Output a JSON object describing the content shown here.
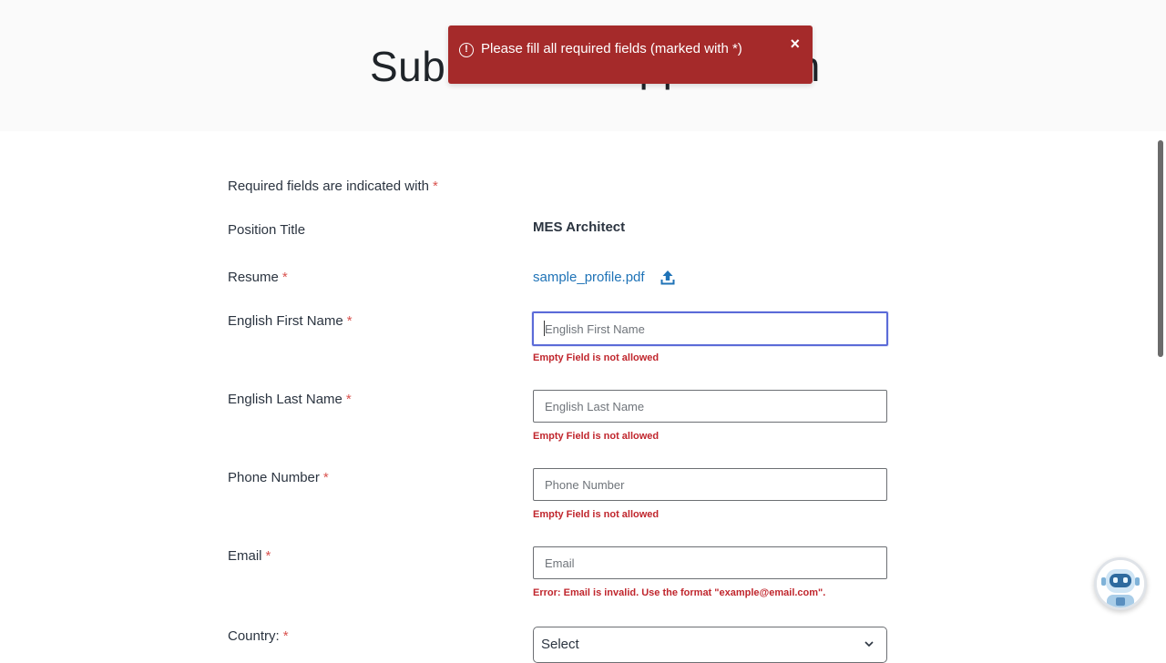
{
  "header": {
    "title": "Submit Your Application"
  },
  "toast": {
    "icon": "alert-circle-icon",
    "message": "Please fill all required fields (marked with *)",
    "close": "×"
  },
  "form": {
    "required_note": "Required fields are indicated with",
    "required_marker": "*",
    "position_title": {
      "label": "Position Title",
      "value": "MES Architect"
    },
    "resume": {
      "label": "Resume",
      "file_name": "sample_profile.pdf",
      "icon": "upload-icon"
    },
    "first_name": {
      "label": "English First Name",
      "placeholder": "English First Name",
      "value": "",
      "error": "Empty Field is not allowed"
    },
    "last_name": {
      "label": "English Last Name",
      "placeholder": "English Last Name",
      "value": "",
      "error": "Empty Field is not allowed"
    },
    "phone": {
      "label": "Phone Number",
      "placeholder": "Phone Number",
      "value": "",
      "error": "Empty Field is not allowed"
    },
    "email": {
      "label": "Email",
      "placeholder": "Email",
      "value": "",
      "error": "Error: Email is invalid. Use the format \"example@email.com\"."
    },
    "country": {
      "label": "Country:",
      "selected": "Select",
      "icon": "chevron-down-icon"
    }
  },
  "chatbot": {
    "icon": "robot-icon"
  },
  "colors": {
    "toast_bg": "#a52a2a",
    "error_text": "#c0262d",
    "link": "#1f73b7",
    "required_star": "#d9534f",
    "focus_border": "#5b6bd8"
  }
}
